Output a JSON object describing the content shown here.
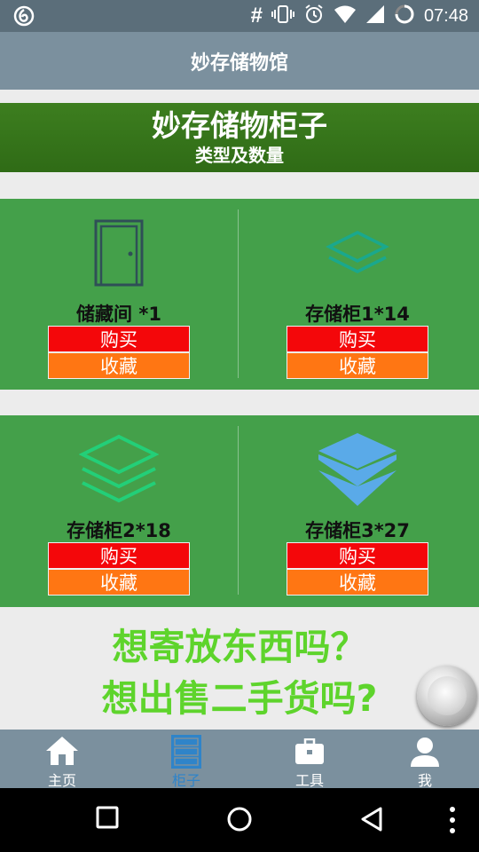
{
  "status_bar": {
    "time": "07:48",
    "hash": "#"
  },
  "app_bar": {
    "title": "妙存储物馆"
  },
  "banner": {
    "title": "妙存储物柜子",
    "subtitle": "类型及数量"
  },
  "cards": [
    {
      "name": "储藏间  *1",
      "icon": "door-icon",
      "buy": "购买",
      "fav": "收藏"
    },
    {
      "name": "存储柜1*14",
      "icon": "layers-outline-icon",
      "buy": "购买",
      "fav": "收藏"
    },
    {
      "name": "存储柜2*18",
      "icon": "stack-outline-icon",
      "buy": "购买",
      "fav": "收藏"
    },
    {
      "name": "存储柜3*27",
      "icon": "stack-filled-icon",
      "buy": "购买",
      "fav": "收藏"
    }
  ],
  "promo": {
    "line1": "想寄放东西吗？",
    "line2": "想出售二手货吗?"
  },
  "tabs": [
    {
      "label": "主页",
      "icon": "home-icon"
    },
    {
      "label": "柜子",
      "icon": "cabinet-icon",
      "active": true
    },
    {
      "label": "工具",
      "icon": "toolbox-icon"
    },
    {
      "label": "我",
      "icon": "person-icon"
    }
  ],
  "colors": {
    "accent_green": "#44a04a",
    "buy_red": "#f4070a",
    "fav_orange": "#ff7613",
    "promo_green": "#5ed42c",
    "tab_active": "#2f84c9"
  }
}
